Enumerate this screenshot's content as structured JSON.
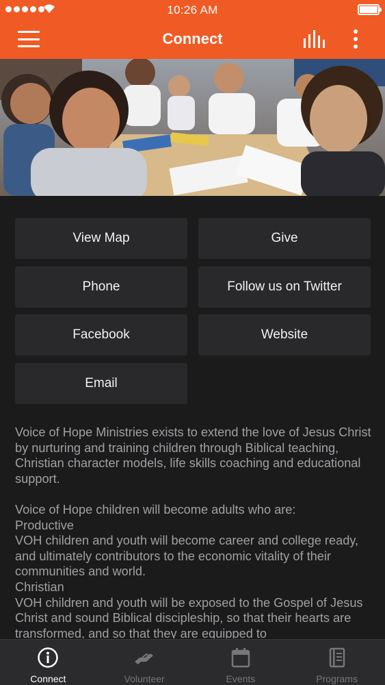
{
  "status_bar": {
    "time": "10:26 AM",
    "signal_icon": "signal-dots-icon",
    "wifi_icon": "wifi-icon",
    "battery_icon": "battery-icon"
  },
  "app_bar": {
    "title": "Connect",
    "menu_icon": "hamburger-menu-icon",
    "audio_icon": "audio-bars-icon",
    "more_icon": "more-vertical-icon",
    "background": "#f05a24"
  },
  "hero_image": {
    "subject": "children in classroom photo"
  },
  "actions": {
    "view_map": "View Map",
    "give": "Give",
    "phone": "Phone",
    "twitter": "Follow us on Twitter",
    "facebook": "Facebook",
    "website": "Website",
    "email": "Email"
  },
  "description": {
    "mission": "Voice of Hope Ministries exists to extend the love of Jesus Christ by nurturing and training children through Biblical teaching, Christian character models, life skills coaching and educational support.",
    "intro": "Voice of Hope children will become adults who are:",
    "heading_1": "Productive",
    "text_1": "VOH children and youth will become career and college ready, and ultimately contributors to the economic vitality of their communities and world.",
    "heading_2": "Christian",
    "text_2": "VOH children and youth will be exposed to the Gospel of Jesus Christ and sound Biblical discipleship, so that their hearts are transformed, and so that they are equipped to"
  },
  "tabs": [
    {
      "label": "Connect",
      "icon": "info-icon",
      "active": true
    },
    {
      "label": "Volunteer",
      "icon": "helping-hand-icon",
      "active": false
    },
    {
      "label": "Events",
      "icon": "calendar-icon",
      "active": false
    },
    {
      "label": "Programs",
      "icon": "book-icon",
      "active": false
    }
  ],
  "colors": {
    "accent": "#f05a24",
    "background": "#1b1b1c",
    "button": "#29292b",
    "tab_bar": "#2b2b2d"
  }
}
